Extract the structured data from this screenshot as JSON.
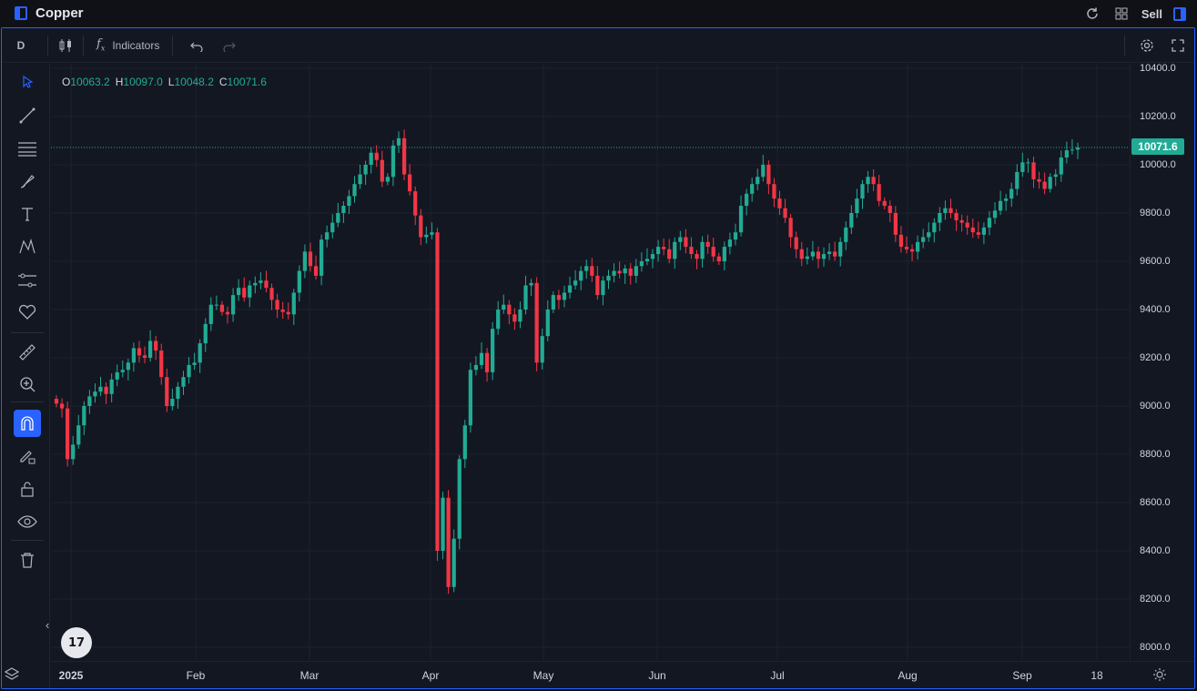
{
  "app": {
    "title": "Copper",
    "sell_label": "Sell"
  },
  "toolbar": {
    "interval": "D",
    "indicators_label": "Indicators"
  },
  "ohlc": {
    "o_label": "O",
    "o": "10063.2",
    "h_label": "H",
    "h": "10097.0",
    "l_label": "L",
    "l": "10048.2",
    "c_label": "C",
    "c": "10071.6"
  },
  "last_price": "10071.6",
  "colors": {
    "up": "#22ab94",
    "down": "#f23645",
    "accent": "#2962ff",
    "background": "#131722"
  },
  "price_axis": [
    "10400.0",
    "10200.0",
    "10000.0",
    "9800.0",
    "9600.0",
    "9400.0",
    "9200.0",
    "9000.0",
    "8800.0",
    "8600.0",
    "8400.0",
    "8200.0",
    "8000.0"
  ],
  "time_axis": [
    "2025",
    "Feb",
    "Mar",
    "Apr",
    "May",
    "Jun",
    "Jul",
    "Aug",
    "Sep",
    "18"
  ],
  "left_tools": [
    "cursor-icon",
    "trend-line-icon",
    "fib-lines-icon",
    "brush-icon",
    "text-icon",
    "pattern-icon",
    "forecast-icon",
    "heart-icon",
    "ruler-icon",
    "zoom-in-icon",
    "magnet-icon",
    "pencil-lock-icon",
    "lock-icon",
    "eye-icon",
    "trash-icon"
  ],
  "chart_data": {
    "type": "candlestick",
    "title": "Copper",
    "interval": "D",
    "ylim": [
      8000,
      10400
    ],
    "x_ticks": [
      "2025",
      "Feb",
      "Mar",
      "Apr",
      "May",
      "Jun",
      "Jul",
      "Aug",
      "Sep",
      "18"
    ],
    "close": [
      9010,
      8990,
      8780,
      8840,
      8920,
      9000,
      9040,
      9060,
      9080,
      9050,
      9110,
      9140,
      9150,
      9180,
      9240,
      9210,
      9200,
      9270,
      9230,
      9120,
      9000,
      9030,
      9080,
      9120,
      9170,
      9180,
      9260,
      9340,
      9420,
      9420,
      9390,
      9380,
      9460,
      9490,
      9450,
      9500,
      9510,
      9520,
      9490,
      9440,
      9400,
      9390,
      9380,
      9470,
      9560,
      9640,
      9580,
      9540,
      9690,
      9720,
      9760,
      9800,
      9830,
      9870,
      9920,
      9960,
      10000,
      10050,
      10020,
      9930,
      9950,
      10080,
      10110,
      9960,
      9890,
      9790,
      9700,
      9710,
      9720,
      8400,
      8620,
      8250,
      8450,
      8780,
      8920,
      9150,
      9170,
      9220,
      9140,
      9320,
      9400,
      9420,
      9380,
      9350,
      9400,
      9500,
      9510,
      9180,
      9290,
      9400,
      9460,
      9440,
      9470,
      9500,
      9520,
      9560,
      9580,
      9540,
      9460,
      9520,
      9540,
      9560,
      9550,
      9570,
      9540,
      9580,
      9600,
      9610,
      9630,
      9660,
      9650,
      9610,
      9680,
      9700,
      9660,
      9630,
      9610,
      9680,
      9660,
      9620,
      9600,
      9660,
      9690,
      9720,
      9830,
      9880,
      9920,
      9950,
      10000,
      9920,
      9860,
      9820,
      9780,
      9700,
      9650,
      9610,
      9620,
      9640,
      9610,
      9630,
      9640,
      9620,
      9680,
      9740,
      9800,
      9860,
      9920,
      9950,
      9920,
      9850,
      9830,
      9800,
      9710,
      9660,
      9650,
      9640,
      9680,
      9700,
      9720,
      9760,
      9800,
      9820,
      9800,
      9770,
      9760,
      9740,
      9720,
      9710,
      9740,
      9780,
      9810,
      9850,
      9860,
      9900,
      9970,
      10010,
      10010,
      9940,
      9930,
      9900,
      9950,
      9960,
      10030,
      10060,
      10063,
      10071.6
    ]
  }
}
